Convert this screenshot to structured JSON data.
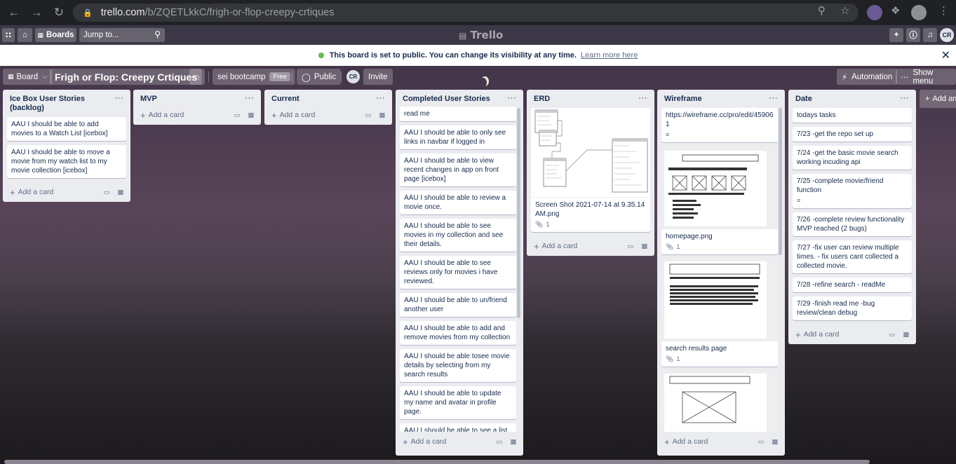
{
  "browser": {
    "url_host": "trello.com",
    "url_path": "/b/ZQETLkkC/frigh-or-flop-creepy-crtiques",
    "back_icon": "arrow-left-icon",
    "forward_icon": "arrow-right-icon",
    "reload_icon": "reload-icon"
  },
  "header": {
    "boards_label": "Boards",
    "jump_placeholder": "Jump to...",
    "logo": "Trello",
    "avatar_initials": "CR"
  },
  "banner": {
    "message": "This board is set to public. You can change its visibility at any time.",
    "link": "Learn more here"
  },
  "board": {
    "view_label": "Board",
    "name": "Frigh or Flop: Creepy Crtiques",
    "workspace": "sei bootcamp",
    "workspace_plan": "Free",
    "visibility": "Public",
    "member_initials": "CR",
    "invite_label": "Invite",
    "automation_label": "Automation",
    "show_menu_label": "Show menu",
    "add_list_label": "Add an"
  },
  "lists": [
    {
      "title": "Ice Box User Stories (backlog)",
      "add_label": "Add a card",
      "cards": [
        "AAU I should be able to add movies to a Watch List [icebox]",
        "AAU I should be able to move a movie from my watch list to my movie collection [icebox]"
      ]
    },
    {
      "title": "MVP",
      "add_label": "Add a card",
      "cards": []
    },
    {
      "title": "Current",
      "add_label": "Add a card",
      "cards": []
    },
    {
      "title": "Completed User Stories",
      "add_label": "Add a card",
      "cards": [
        "read me",
        "AAU I should be able to only see links in navbar if logged in",
        "AAU I should be able to view recent changes in app on front page [icebox]",
        "AAU I should be able to review a movie once.",
        "AAU I should be able to see movies in my collection and see their details.",
        "AAU I should be able to see reviews only for movies i have reviewed.",
        "AAU I should be able to un/friend another user",
        "AAU I should be able to add and remove movies from my collection",
        "AAU I should be able tosee movie details by selecting from my search results",
        "AAU I should be able to update my name and avatar in profile page.",
        "AAU I should be able to see a list of friends on my profile page"
      ]
    },
    {
      "title": "ERD",
      "add_label": "Add a card",
      "cards": [
        {
          "text": "Screen Shot 2021-07-14 at 9.35.14 AM.png",
          "attachments": "1"
        }
      ]
    },
    {
      "title": "Wireframe",
      "add_label": "Add a card",
      "cards": [
        {
          "text": "https://wireframe.cc/pro/edit/459061"
        },
        {
          "text": "homepage.png",
          "attachments": "1"
        },
        {
          "text": "search results page",
          "attachments": "1"
        }
      ]
    },
    {
      "title": "Date",
      "add_label": "Add a card",
      "cards": [
        "todays tasks",
        "7/23 -get the repo set up",
        "7/24 -get the basic movie search working incuding api",
        "7/25 -complete movie/friend function",
        "7/26 -complete review functionality MVP reached (2 bugs)",
        "7/27 -fix user can review multiple times. - fix users cant collected a collected movie.",
        "7/28 -refine search - readMe",
        "7/29 -finish read me -bug review/clean debug"
      ]
    }
  ]
}
